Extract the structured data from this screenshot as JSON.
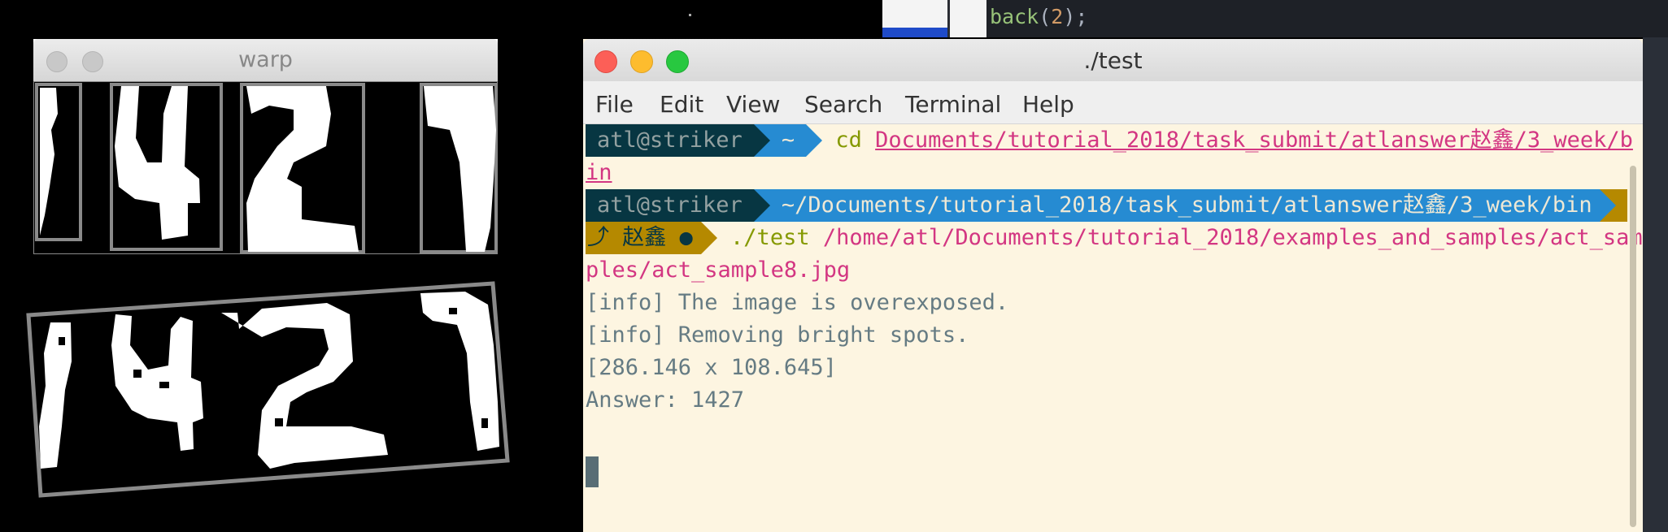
{
  "background_editor": {
    "code_fn": "back",
    "code_open": "(",
    "code_num": "2",
    "code_close": ");"
  },
  "warp_window": {
    "title": "warp"
  },
  "terminal": {
    "title": "./test",
    "menu": [
      "File",
      "Edit",
      "View",
      "Search",
      "Terminal",
      "Help"
    ],
    "prompt1": {
      "user_host": "atl@striker",
      "dir": "~",
      "cmd": "cd",
      "arg_line1": "Documents/tutorial_2018/task_submit/atlanswer赵鑫/3_week/b",
      "arg_line2": "in"
    },
    "prompt2": {
      "user_host": "atl@striker",
      "dir": "~/Documents/tutorial_2018/task_submit/atlanswer赵鑫/3_week/bin",
      "branch": "⤴ 赵鑫 ●",
      "cmd": "./test",
      "arg_line1": "/home/atl/Documents/tutorial_2018/examples_and_samples/act_sam",
      "arg_line2": "ples/act_sample8.jpg"
    },
    "output": [
      "[info] The image is overexposed.",
      "[info] Removing bright spots.",
      "[286.146 x 108.645]",
      "Answer: 1427"
    ]
  },
  "colors": {
    "terminal_bg": "#fdf5e1",
    "prompt_user_bg": "#073642",
    "prompt_dir_bg": "#268bd2",
    "git_bg": "#b58900",
    "path_magenta": "#d33682",
    "cmd_yellow": "#859900",
    "text": "#657b83"
  }
}
